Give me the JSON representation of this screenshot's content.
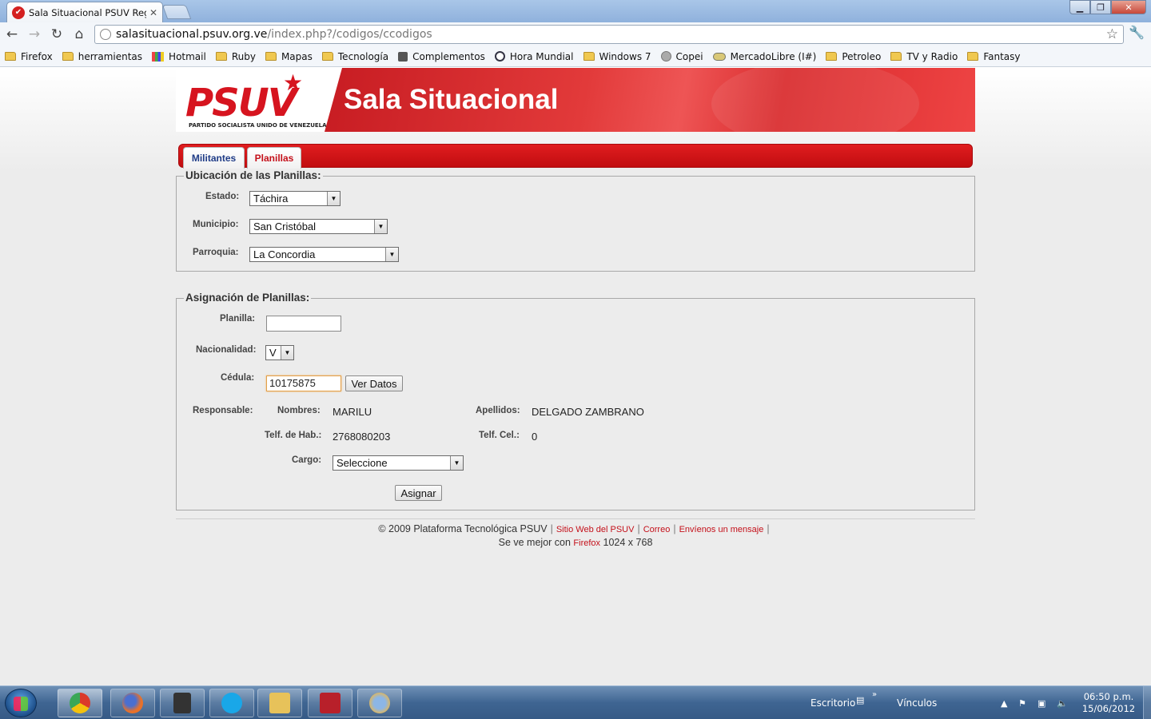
{
  "browser": {
    "tab_title": "Sala Situacional PSUV Regió",
    "url_host": "salasituacional.psuv.org.ve",
    "url_path": "/index.php?/codigos/ccodigos",
    "bookmarks": [
      "Firefox",
      "herramientas",
      "Hotmail",
      "Ruby",
      "Mapas",
      "Tecnología",
      "Complementos",
      "Hora Mundial",
      "Windows 7",
      "Copei",
      "MercadoLibre (I#)",
      "Petroleo",
      "TV y Radio",
      "Fantasy"
    ]
  },
  "banner": {
    "logo": "PSUV",
    "logo_subtitle": "PARTIDO SOCIALISTA UNIDO DE VENEZUELA",
    "title": "Sala Situacional"
  },
  "nav": {
    "tabs": [
      "Militantes",
      "Planillas"
    ],
    "active_tab": "Planillas"
  },
  "ubicacion": {
    "legend": "Ubicación de las Planillas:",
    "estado_label": "Estado:",
    "estado_value": "Táchira",
    "municipio_label": "Municipio:",
    "municipio_value": "San Cristóbal",
    "parroquia_label": "Parroquia:",
    "parroquia_value": "La Concordia"
  },
  "asignacion": {
    "legend": "Asignación de Planillas:",
    "planilla_label": "Planilla:",
    "planilla_value": "",
    "nacionalidad_label": "Nacionalidad:",
    "nacionalidad_value": "V",
    "cedula_label": "Cédula:",
    "cedula_value": "10175875",
    "ver_datos_button": "Ver Datos",
    "responsable_label": "Responsable:",
    "nombres_label": "Nombres:",
    "nombres_value": "MARILU",
    "apellidos_label": "Apellidos:",
    "apellidos_value": "DELGADO ZAMBRANO",
    "telf_hab_label": "Telf. de Hab.:",
    "telf_hab_value": "2768080203",
    "telf_cel_label": "Telf. Cel.:",
    "telf_cel_value": "0",
    "cargo_label": "Cargo:",
    "cargo_value": "Seleccione",
    "asignar_button": "Asignar"
  },
  "footer": {
    "copyright": "© 2009 Plataforma Tecnológica PSUV",
    "links": [
      "Sitio Web del PSUV",
      "Correo",
      "Envíenos un mensaje"
    ],
    "best_viewed_prefix": "Se ve mejor con",
    "best_viewed_browser": "Firefox",
    "best_viewed_resolution": "1024 x 768"
  },
  "taskbar": {
    "escritorio": "Escritorio",
    "vinculos": "Vínculos",
    "time": "06:50 p.m.",
    "date": "15/06/2012"
  },
  "colors": {
    "brand_red": "#d6141f",
    "nav_blue": "#1f3c87"
  }
}
